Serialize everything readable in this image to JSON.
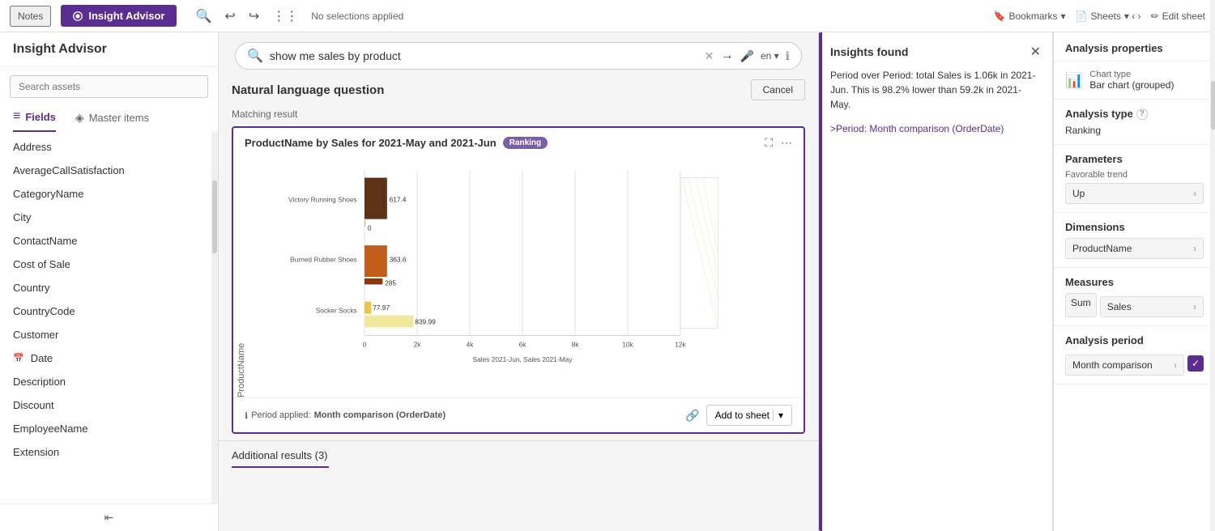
{
  "topbar": {
    "notes_label": "Notes",
    "insight_label": "Insight Advisor",
    "selections": "No selections applied",
    "bookmarks": "Bookmarks",
    "sheets": "Sheets",
    "edit_sheet": "Edit sheet"
  },
  "left_panel": {
    "title": "Insight Advisor",
    "search_placeholder": "Search assets",
    "tabs": [
      "Fields",
      "Master items"
    ],
    "active_tab": "Fields",
    "fields_tab_label": "Fields",
    "master_items_label": "Master items",
    "field_list": [
      {
        "name": "Address",
        "icon": false
      },
      {
        "name": "AverageCallSatisfaction",
        "icon": false
      },
      {
        "name": "CategoryName",
        "icon": false
      },
      {
        "name": "City",
        "icon": false
      },
      {
        "name": "ContactName",
        "icon": false
      },
      {
        "name": "Cost of Sale",
        "icon": false
      },
      {
        "name": "Country",
        "icon": false
      },
      {
        "name": "CountryCode",
        "icon": false
      },
      {
        "name": "Customer",
        "icon": false
      },
      {
        "name": "Date",
        "icon": true
      },
      {
        "name": "Description",
        "icon": false
      },
      {
        "name": "Discount",
        "icon": false
      },
      {
        "name": "EmployeeName",
        "icon": false
      },
      {
        "name": "Extension",
        "icon": false
      }
    ]
  },
  "search_bar": {
    "query": "show me sales by product",
    "lang": "en"
  },
  "nlq": {
    "title": "Natural language question",
    "cancel_label": "Cancel",
    "matching_label": "Matching result"
  },
  "chart": {
    "title": "ProductName by Sales for 2021-May and 2021-Jun",
    "badge": "Ranking",
    "products": [
      "Victory Running Shoes",
      "Burned Rubber Shoes",
      "Socker Socks"
    ],
    "values_jun": [
      617.4,
      363.6,
      77.97
    ],
    "values_may": [
      0,
      285,
      839.99
    ],
    "x_labels": [
      "0",
      "2k",
      "4k",
      "6k",
      "8k",
      "10k",
      "12k"
    ],
    "x_axis_label": "Sales 2021-Jun, Sales 2021-May",
    "y_axis_label": "ProductName",
    "period_label": "Period applied:",
    "period_value": "Month comparison (OrderDate)",
    "add_sheet_label": "Add to sheet"
  },
  "insights": {
    "title": "Insights found",
    "text": "Period over Period: total Sales is 1.06k in 2021-Jun. This is 98.2% lower than 59.2k in 2021-May.",
    "period_link": ">Period: Month comparison (OrderDate)"
  },
  "analysis_props": {
    "title": "Analysis properties",
    "chart_type_label": "Chart type",
    "chart_type_value": "Bar chart (grouped)",
    "analysis_type_title": "Analysis type",
    "analysis_type_value": "Ranking",
    "parameters_title": "Parameters",
    "favorable_trend_label": "Favorable trend",
    "favorable_trend_value": "Up",
    "dimensions_title": "Dimensions",
    "dimensions_value": "ProductName",
    "measures_title": "Measures",
    "measures_sum": "Sum",
    "measures_sales": "Sales",
    "analysis_period_title": "Analysis period",
    "analysis_period_value": "Month comparison"
  },
  "additional_results": {
    "label": "Additional results (3)"
  }
}
